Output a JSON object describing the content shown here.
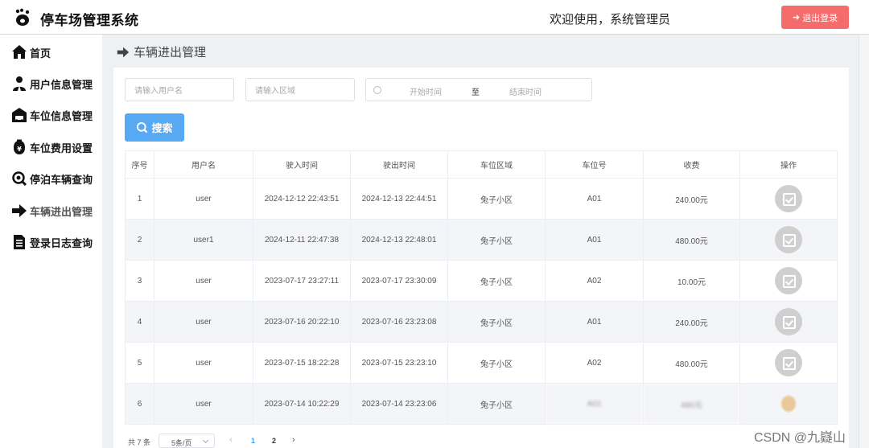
{
  "header": {
    "app_title": "停车场管理系统",
    "welcome": "欢迎使用，系统管理员",
    "logout_label": "退出登录"
  },
  "sidebar": {
    "items": [
      {
        "label": "首页",
        "icon": "home-icon"
      },
      {
        "label": "用户信息管理",
        "icon": "user-icon"
      },
      {
        "label": "车位信息管理",
        "icon": "garage-icon"
      },
      {
        "label": "车位费用设置",
        "icon": "fee-icon"
      },
      {
        "label": "停泊车辆查询",
        "icon": "search-icon"
      },
      {
        "label": "车辆进出管理",
        "icon": "arrow-right-icon",
        "active": true
      },
      {
        "label": "登录日志查询",
        "icon": "document-icon"
      }
    ]
  },
  "page": {
    "title": "车辆进出管理"
  },
  "filters": {
    "username_placeholder": "请输入用户名",
    "area_placeholder": "请输入区域",
    "start_placeholder": "开始时间",
    "range_separator": "至",
    "end_placeholder": "结束时间",
    "search_label": "搜索"
  },
  "table": {
    "columns": [
      "序号",
      "用户名",
      "驶入时间",
      "驶出时间",
      "车位区域",
      "车位号",
      "收费",
      "操作"
    ],
    "rows": [
      {
        "no": "1",
        "user": "user",
        "in": "2024-12-12 22:43:51",
        "out": "2024-12-13 22:44:51",
        "area": "兔子小区",
        "spot": "A01",
        "fee": "240.00元"
      },
      {
        "no": "2",
        "user": "user1",
        "in": "2024-12-11 22:47:38",
        "out": "2024-12-13 22:48:01",
        "area": "兔子小区",
        "spot": "A01",
        "fee": "480.00元"
      },
      {
        "no": "3",
        "user": "user",
        "in": "2023-07-17 23:27:11",
        "out": "2023-07-17 23:30:09",
        "area": "兔子小区",
        "spot": "A02",
        "fee": "10.00元"
      },
      {
        "no": "4",
        "user": "user",
        "in": "2023-07-16 20:22:10",
        "out": "2023-07-16 23:23:08",
        "area": "兔子小区",
        "spot": "A01",
        "fee": "240.00元"
      },
      {
        "no": "5",
        "user": "user",
        "in": "2023-07-15 18:22:28",
        "out": "2023-07-15 23:23:10",
        "area": "兔子小区",
        "spot": "A02",
        "fee": "480.00元"
      },
      {
        "no": "6",
        "user": "user",
        "in": "2023-07-14 10:22:29",
        "out": "2023-07-14 23:23:06",
        "area": "兔子小区",
        "spot": "A01",
        "fee": "480元"
      }
    ]
  },
  "pagination": {
    "total": "共 7 条",
    "page_size": "5条/页",
    "pages": [
      "1",
      "2"
    ],
    "current": "1"
  },
  "watermark": "CSDN @九嶷山",
  "colors": {
    "logout": "#f56c6c",
    "primary": "#58a9f4",
    "active_page": "#409eff",
    "content_bg": "#eef1f4"
  }
}
